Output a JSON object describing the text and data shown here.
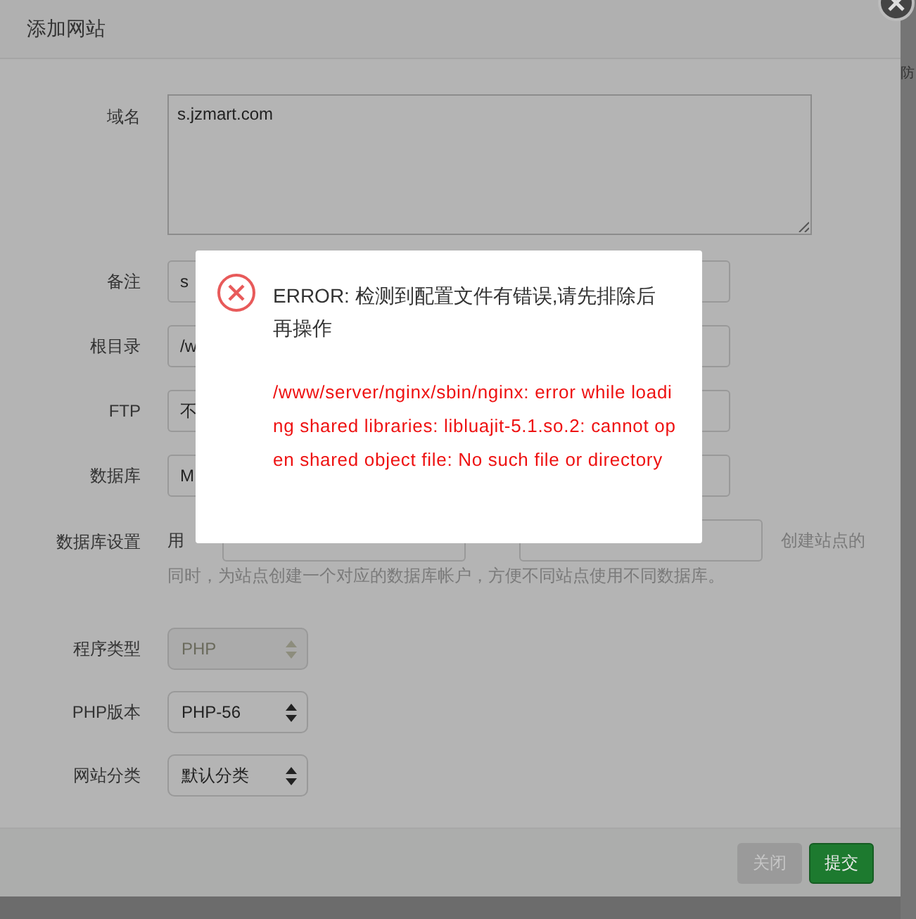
{
  "background": {
    "column_text": "防"
  },
  "dialog": {
    "title": "添加网站",
    "fields": [
      {
        "label": "域名",
        "kind": "textarea",
        "value": "s.jzmart.com"
      },
      {
        "label": "备注",
        "kind": "input",
        "value": "s"
      },
      {
        "label": "根目录",
        "kind": "input",
        "value": "/w"
      },
      {
        "label": "FTP",
        "kind": "select",
        "value": "不",
        "disabled": false
      },
      {
        "label": "数据库",
        "kind": "select",
        "value": "M",
        "disabled": false
      }
    ],
    "database_settings": {
      "label": "数据库设置",
      "user_label": "用",
      "hint_lines": [
        "创建站点的",
        "同时，为站点创建一个对应的数据库帐户，方便不同站点使用不同数据库。"
      ]
    },
    "selects": [
      {
        "label": "程序类型",
        "value": "PHP",
        "disabled": true
      },
      {
        "label": "PHP版本",
        "value": "PHP-56",
        "disabled": false
      },
      {
        "label": "网站分类",
        "value": "默认分类",
        "disabled": false
      }
    ],
    "buttons": [
      {
        "label": "关闭",
        "kind": "secondary"
      },
      {
        "label": "提交",
        "kind": "primary"
      }
    ]
  },
  "error_popup": {
    "message": "ERROR: 检测到配置文件有错误,请先排除后再操作",
    "detail": "/www/server/nginx/sbin/nginx: error while loading shared libraries: libluajit-5.1.so.2: cannot open shared object file: No such file or directory"
  }
}
